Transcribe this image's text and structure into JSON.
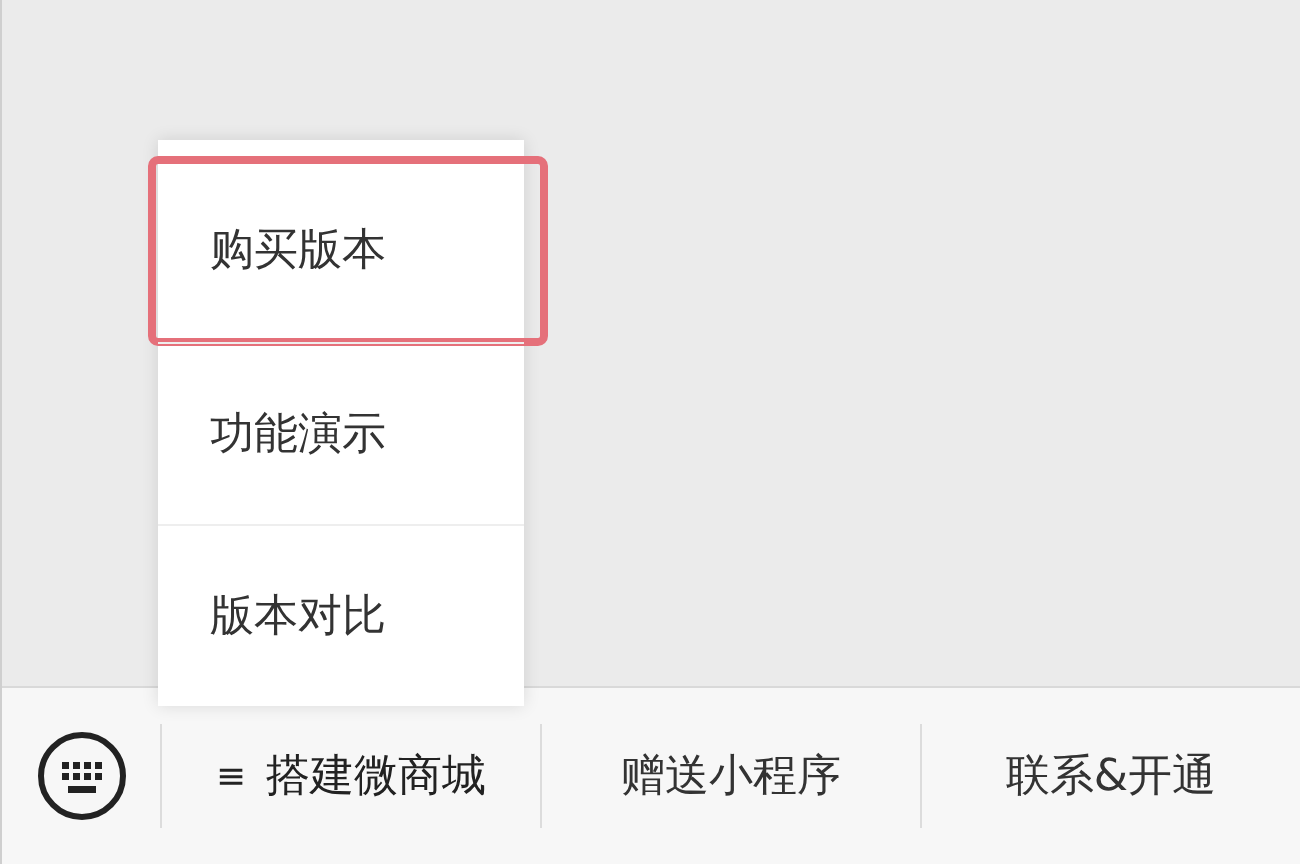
{
  "submenu": {
    "items": [
      {
        "label": "购买版本",
        "selected": true
      },
      {
        "label": "功能演示",
        "selected": false
      },
      {
        "label": "版本对比",
        "selected": false
      }
    ]
  },
  "menu_bar": {
    "buttons": [
      {
        "label": "搭建微商城",
        "mark": "≡",
        "expanded": true
      },
      {
        "label": "赠送小程序",
        "expanded": false
      },
      {
        "label": "联系&开通",
        "expanded": false
      }
    ]
  }
}
